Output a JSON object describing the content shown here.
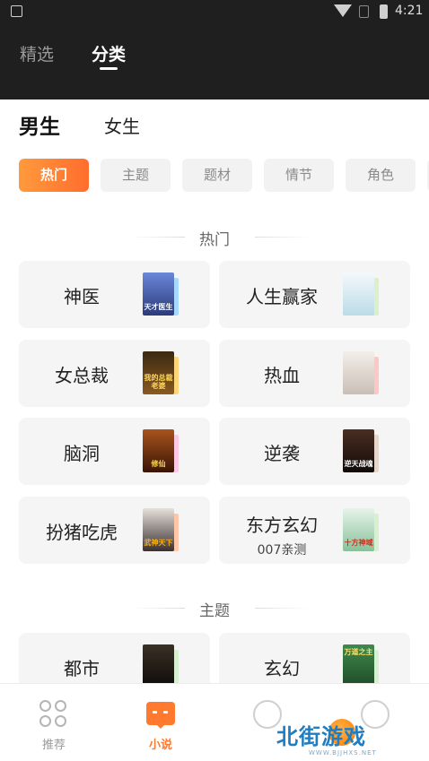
{
  "status_bar": {
    "time": "4:21"
  },
  "header": {
    "tabs": [
      {
        "label": "精选"
      },
      {
        "label": "分类"
      }
    ]
  },
  "gender_tabs": [
    {
      "label": "男生"
    },
    {
      "label": "女生"
    }
  ],
  "filter_chips": [
    {
      "label": "热门"
    },
    {
      "label": "主题"
    },
    {
      "label": "题材"
    },
    {
      "label": "情节"
    },
    {
      "label": "角色"
    }
  ],
  "sections": [
    {
      "title": "热门",
      "items": [
        {
          "label": "神医",
          "cover_text": "天才医生",
          "cover_color": "#3b4fa8",
          "accent": "#a7d8ff"
        },
        {
          "label": "人生赢家",
          "cover_text": "",
          "cover_color": "#cfe8f2",
          "accent": "#d9f0c8"
        },
        {
          "label": "女总裁",
          "cover_text": "我的总裁老婆",
          "cover_color": "#5a3a1a",
          "accent": "#ffd57a"
        },
        {
          "label": "热血",
          "cover_text": "",
          "cover_color": "#e8e2dc",
          "accent": "#ffc6c6"
        },
        {
          "label": "脑洞",
          "cover_text": "修仙",
          "cover_color": "#6b2a10",
          "accent": "#ffc9e6"
        },
        {
          "label": "逆袭",
          "cover_text": "逆天战魂",
          "cover_color": "#2a1a14",
          "accent": "#e8d6c8"
        },
        {
          "label": "扮猪吃虎",
          "cover_text": "武神天下",
          "cover_color": "#3a3030",
          "accent": "#ffc6a8"
        },
        {
          "label": "东方玄幻",
          "sub": "007亲测",
          "cover_text": "十方神域",
          "cover_color": "#bfe0c8",
          "accent": "#d6f0d0"
        }
      ]
    },
    {
      "title": "主题",
      "items": [
        {
          "label": "都市",
          "cover_text": "",
          "cover_color": "#1e1a16",
          "accent": "#d6f0d0"
        },
        {
          "label": "玄幻",
          "cover_text": "万道之主",
          "cover_color": "#2e6a3a",
          "accent": "#d6f0d0"
        }
      ]
    }
  ],
  "bottom_nav": [
    {
      "label": "推荐",
      "icon": "grid-icon"
    },
    {
      "label": "小说",
      "icon": "book-icon"
    },
    {
      "label": "",
      "icon": "heart-icon"
    },
    {
      "label": "",
      "icon": "profile-icon"
    }
  ],
  "watermark": {
    "text": "北街游戏",
    "url": "WWW.BJJHXS.NET"
  },
  "colors": {
    "accent": "#ff7a2e",
    "header_bg": "#1f1f1f",
    "card_bg": "#f5f5f5"
  }
}
